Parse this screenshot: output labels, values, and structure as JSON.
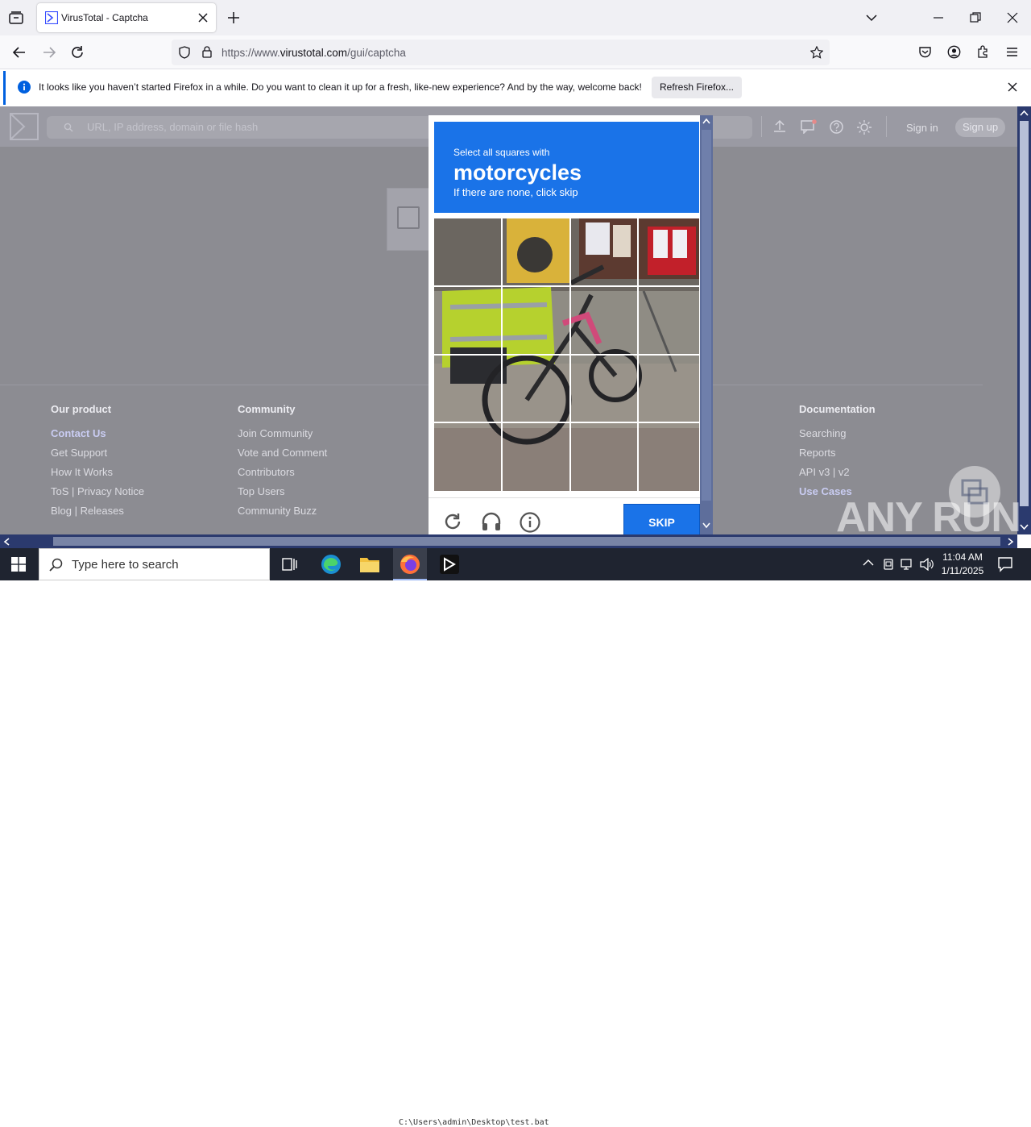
{
  "browser": {
    "tab_title": "VirusTotal - Captcha",
    "url_prefix": "https://www.",
    "url_host": "virustotal.com",
    "url_path": "/gui/captcha"
  },
  "notification": {
    "message": "It looks like you haven’t started Firefox in a while. Do you want to clean it up for a fresh, like-new experience? And by the way, welcome back!",
    "button_label": "Refresh Firefox..."
  },
  "vt_header": {
    "search_placeholder": "URL, IP address, domain or file hash",
    "sign_in": "Sign in",
    "sign_up": "Sign up"
  },
  "footer": {
    "columns": [
      {
        "heading": "Our product",
        "items": [
          "Contact Us",
          "Get Support",
          "How It Works",
          "ToS | Privacy Notice",
          "Blog | Releases"
        ]
      },
      {
        "heading": "Community",
        "items": [
          "Join Community",
          "Vote and Comment",
          "Contributors",
          "Top Users",
          "Community Buzz"
        ]
      },
      {
        "heading": "Documentation",
        "items": [
          "Searching",
          "Reports",
          "API v3 | v2",
          "Use Cases"
        ]
      }
    ]
  },
  "captcha": {
    "instruction": "Select all squares with",
    "target": "motorcycles",
    "fallback": "If there are none, click skip",
    "skip_label": "SKIP"
  },
  "taskbar": {
    "search_placeholder": "Type here to search",
    "time": "11:04 AM",
    "date": "1/11/2025",
    "cmd_text": "C:\\Users\\admin\\Desktop\\test.bat"
  },
  "watermark": "ANY RUN",
  "colors": {
    "captcha_blue": "#1a73e8",
    "firefox_accent": "#0060df",
    "taskbar": "#1f2430"
  }
}
